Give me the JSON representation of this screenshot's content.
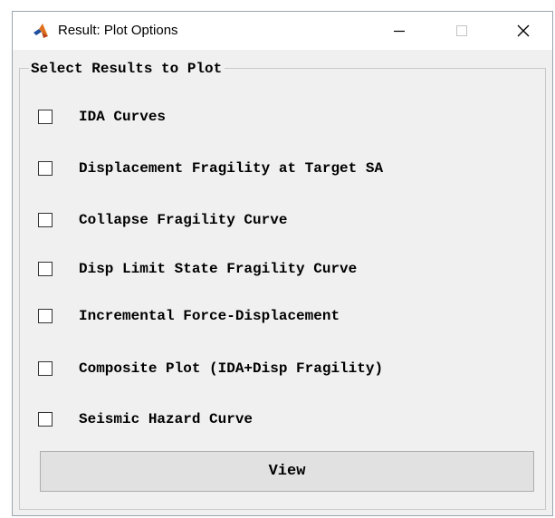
{
  "window": {
    "title": "Result: Plot Options",
    "icon": "matlab-logo-icon",
    "controls": [
      "minimize-icon",
      "maximize-icon",
      "close-icon"
    ]
  },
  "group": {
    "title": "Select Results to Plot"
  },
  "options": [
    {
      "label": "IDA Curves",
      "checked": false
    },
    {
      "label": "Displacement Fragility at Target SA",
      "checked": false
    },
    {
      "label": "Collapse Fragility Curve",
      "checked": false
    },
    {
      "label": "Disp Limit State Fragility Curve",
      "checked": false
    },
    {
      "label": "Incremental Force-Displacement",
      "checked": false
    },
    {
      "label": "Composite Plot (IDA+Disp Fragility)",
      "checked": false
    },
    {
      "label": "Seismic Hazard Curve",
      "checked": false
    }
  ],
  "buttons": {
    "view_label": "View"
  },
  "colors": {
    "window_bg": "#f0f0f0",
    "titlebar_bg": "#ffffff",
    "button_bg": "#e1e1e1",
    "logo_blue": "#1f4e9c",
    "logo_orange": "#e0701e"
  }
}
